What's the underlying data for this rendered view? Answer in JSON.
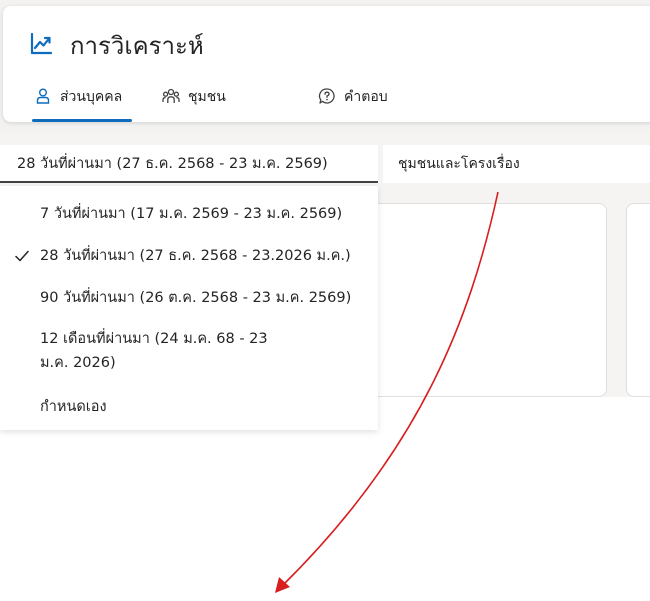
{
  "header": {
    "title": "การวิเคราะห์",
    "tabs": [
      {
        "label": "ส่วนบุคคล",
        "active": true
      },
      {
        "label": "ชุมชน",
        "active": false
      },
      {
        "label": "คำตอบ",
        "active": false
      }
    ]
  },
  "filters": {
    "date_range_selected": "28 วันที่ผ่านมา (27 ธ.ค. 2568 - 23 ม.ค. 2569)",
    "scope_selected": "ชุมชนและโครงเรื่อง"
  },
  "date_menu": {
    "options": [
      {
        "label": "7 วันที่ผ่านมา (17 ม.ค. 2569 - 23 ม.ค. 2569)",
        "selected": false
      },
      {
        "label": "28 วันที่ผ่านมา (27 ธ.ค. 2568 - 23.2026 ม.ค.)",
        "selected": true
      },
      {
        "label": "90 วันที่ผ่านมา (26 ต.ค. 2568 - 23 ม.ค. 2569)",
        "selected": false
      },
      {
        "label": "12 เดือนที่ผ่านมา (24 ม.ค. 68 - 23 ม.ค. 2026)",
        "selected": false
      },
      {
        "label": "กำหนดเอง",
        "selected": false
      }
    ]
  },
  "colors": {
    "accent": "#0f6cbd",
    "annotation_arrow": "#d81e1e"
  },
  "icons": {
    "title": "trend-chart-icon",
    "tab_personal": "person-icon",
    "tab_community": "people-group-icon",
    "tab_answers": "question-bubble-icon",
    "selected": "checkmark-icon"
  }
}
